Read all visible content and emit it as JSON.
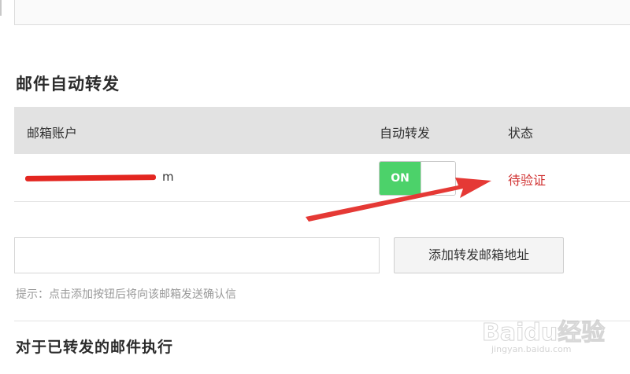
{
  "section": {
    "title": "邮件自动转发"
  },
  "table": {
    "headers": {
      "account": "邮箱账户",
      "auto_forward": "自动转发",
      "status": "状态"
    },
    "rows": [
      {
        "email_visible_fragment": "m",
        "toggle_label": "ON",
        "toggle_state": "on",
        "status": "待验证"
      }
    ]
  },
  "add_form": {
    "input_value": "",
    "button_label": "添加转发邮箱地址",
    "hint": "提示：点击添加按钮后将向该邮箱发送确认信"
  },
  "section2": {
    "title": "对于已转发的邮件执行"
  },
  "watermark": {
    "brand": "Baidu经验",
    "url": "jingyan.baidu.com"
  },
  "colors": {
    "toggle_on": "#4cd26a",
    "status_pending": "#d03030",
    "annotation_arrow": "#e53935",
    "header_bg": "#e2e2e2"
  }
}
